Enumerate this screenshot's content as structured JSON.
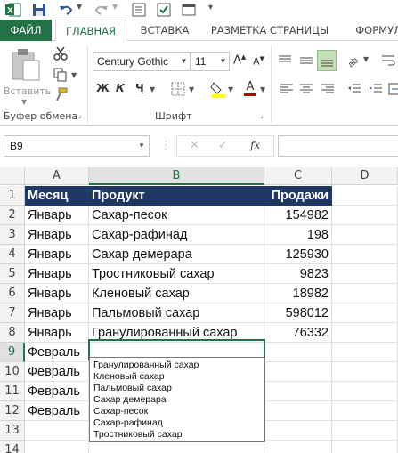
{
  "qat": {
    "icons": [
      "excel-icon",
      "save-icon",
      "undo-icon",
      "redo-icon",
      "form-icon",
      "checkbox-icon",
      "window-icon"
    ]
  },
  "tabs": {
    "file": "ФАЙЛ",
    "home": "ГЛАВНАЯ",
    "insert": "ВСТАВКА",
    "layout": "РАЗМЕТКА СТРАНИЦЫ",
    "formulas": "ФОРМУЛ"
  },
  "ribbon": {
    "paste_label": "Вставить",
    "clipboard_group": "Буфер обмена",
    "font_group": "Шрифт",
    "font_name": "Century Gothic",
    "font_size": "11",
    "bold": "Ж",
    "italic": "К",
    "underline": "Ч",
    "grow_font": "A",
    "shrink_font": "A"
  },
  "formula_bar": {
    "name_box": "B9",
    "fx": "fx",
    "cancel": "✕",
    "enter": "✓"
  },
  "columns": [
    "A",
    "B",
    "C",
    "D"
  ],
  "rows": [
    "1",
    "2",
    "3",
    "4",
    "5",
    "6",
    "7",
    "8",
    "9",
    "10",
    "11",
    "12",
    "13",
    "14"
  ],
  "table": {
    "headers": [
      "Месяц",
      "Продукт",
      "Продажи"
    ],
    "rows": [
      [
        "Январь",
        "Сахар-песок",
        "154982"
      ],
      [
        "Январь",
        "Сахар-рафинад",
        "198"
      ],
      [
        "Январь",
        "Сахар демерара",
        "125930"
      ],
      [
        "Январь",
        "Тростниковый сахар",
        "9823"
      ],
      [
        "Январь",
        "Кленовый сахар",
        "18982"
      ],
      [
        "Январь",
        "Пальмовый сахар",
        "598012"
      ],
      [
        "Январь",
        "Гранулированный сахар",
        "76332"
      ],
      [
        "Февраль",
        "",
        ""
      ],
      [
        "Февраль",
        "",
        ""
      ],
      [
        "Февраль",
        "",
        ""
      ],
      [
        "Февраль",
        "",
        ""
      ]
    ]
  },
  "autocomplete": [
    "Гранулированный сахар",
    "Кленовый сахар",
    "Пальмовый сахар",
    "Сахар демерара",
    "Сахар-песок",
    "Сахар-рафинад",
    "Тростниковый сахар"
  ],
  "colors": {
    "excel_green": "#217346",
    "header_fill": "#1f3864"
  }
}
